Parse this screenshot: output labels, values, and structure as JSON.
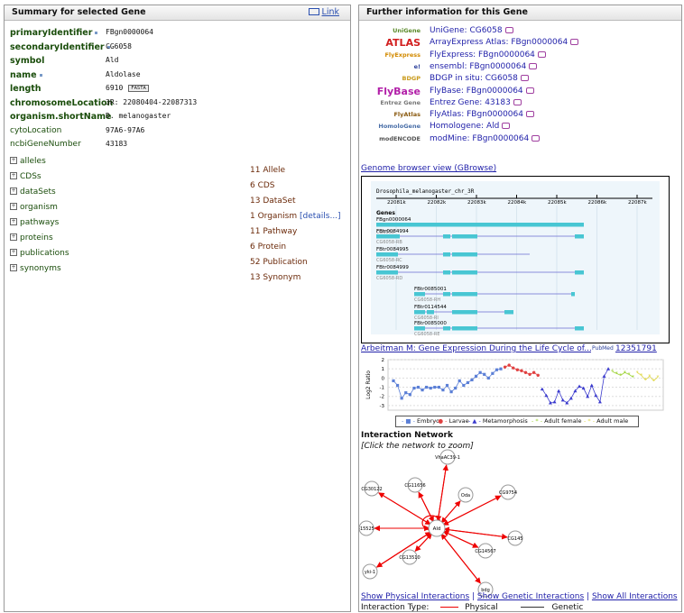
{
  "left_panel": {
    "title": "Summary for selected Gene",
    "link_label": "Link",
    "fields": [
      {
        "key": "primaryIdentifier",
        "value": "FBgn0000064",
        "bold": true,
        "dot": true
      },
      {
        "key": "secondaryIdentifier",
        "value": "CG6058",
        "bold": true,
        "dot": true
      },
      {
        "key": "symbol",
        "value": "Ald",
        "bold": true,
        "dot": false
      },
      {
        "key": "name",
        "value": "Aldolase",
        "bold": true,
        "dot": true
      },
      {
        "key": "length",
        "value": "6910",
        "bold": true,
        "dot": false,
        "fasta": "FASTA"
      },
      {
        "key": "chromosomeLocation",
        "value": "3R: 22080404-22087313",
        "bold": true,
        "dot": false
      },
      {
        "key": "organism.shortName",
        "value": "D. melanogaster",
        "bold": true,
        "dot": false
      },
      {
        "key": "cytoLocation",
        "value": "97A6-97A6",
        "bold": false,
        "dot": false
      },
      {
        "key": "ncbiGeneNumber",
        "value": "43183",
        "bold": false,
        "dot": false
      }
    ],
    "collections": [
      {
        "name": "alleles",
        "count": "11 Allele"
      },
      {
        "name": "CDSs",
        "count": "6 CDS"
      },
      {
        "name": "dataSets",
        "count": "13 DataSet"
      },
      {
        "name": "organism",
        "count": "1 Organism",
        "extra": "[details...]"
      },
      {
        "name": "pathways",
        "count": "11 Pathway"
      },
      {
        "name": "proteins",
        "count": "6 Protein"
      },
      {
        "name": "publications",
        "count": "52 Publication"
      },
      {
        "name": "synonyms",
        "count": "13 Synonym"
      }
    ]
  },
  "right_panel": {
    "title": "Further information for this Gene",
    "links": [
      {
        "logo": "UniGene",
        "logo_color": "#5b8a2a",
        "text": "UniGene: CG6058"
      },
      {
        "logo": "ATLAS",
        "logo_color": "#d21f1f",
        "text": "ArrayExpress Atlas: FBgn0000064"
      },
      {
        "logo": "FlyExpress",
        "logo_color": "#d28a00",
        "text": "FlyExpress: FBgn0000064"
      },
      {
        "logo": "e!",
        "logo_color": "#2a3f9a",
        "text": "ensembl: FBgn0000064"
      },
      {
        "logo": "BDGP",
        "logo_color": "#c99a1a",
        "text": "BDGP in situ: CG6058"
      },
      {
        "logo": "FlyBase",
        "logo_color": "#b21fa8",
        "text": "FlyBase: FBgn0000064"
      },
      {
        "logo": "Entrez Gene",
        "logo_color": "#777777",
        "text": "Entrez Gene: 43183"
      },
      {
        "logo": "FlyAtlas",
        "logo_color": "#8a5a10",
        "text": "FlyAtlas: FBgn0000064"
      },
      {
        "logo": "HomoloGene",
        "logo_color": "#4a6fa8",
        "text": "Homologene: Ald"
      },
      {
        "logo": "modENCODE",
        "logo_color": "#555555",
        "text": "modMine: FBgn0000064"
      }
    ],
    "genome_browser_label": "Genome browser view (GBrowse)",
    "gbrowse": {
      "chrom_label": "Drosophila_melanogaster_chr_3R",
      "ticks": [
        "22081k",
        "22082k",
        "22083k",
        "22084k",
        "22085k",
        "22086k",
        "22087k"
      ],
      "genes_label": "Genes",
      "gene_id": "FBgn0000064",
      "gene_sub": "CG6058",
      "transcripts": [
        {
          "id": "FBtr0084994",
          "sub": "CG6058-RB"
        },
        {
          "id": "FBtr0084995",
          "sub": "CG6058-RC"
        },
        {
          "id": "FBtr0084999",
          "sub": "CG6058-RD"
        },
        {
          "id": "FBtr0085001",
          "sub": "CG6058-RH"
        },
        {
          "id": "FBtr0114544",
          "sub": "CG6058-RI"
        },
        {
          "id": "FBtr0085000",
          "sub": "CG6058-RE"
        }
      ]
    },
    "expression_title": "Arbeitman M: Gene Expression During the Life Cycle of...",
    "pubmed_label": "PubMed",
    "pubmed_id": "12351791",
    "chart_data": {
      "type": "line",
      "ylabel": "Log2 Ratio",
      "ylim": [
        -3.5,
        2
      ],
      "yticks": [
        "2",
        "1",
        "0",
        "-1",
        "-2",
        "-3"
      ],
      "series": [
        {
          "name": "Embryo",
          "color": "#5b7fd6",
          "marker": "square",
          "values": [
            -0.3,
            -0.8,
            -2.2,
            -1.6,
            -1.8,
            -1.1,
            -1.0,
            -1.3,
            -1.0,
            -1.1,
            -1.0,
            -1.0,
            -1.3,
            -0.8,
            -1.5,
            -1.1,
            -0.3,
            -0.8,
            -0.5,
            -0.2,
            0.2,
            0.6,
            0.4,
            0.0,
            0.5,
            0.9,
            1.0
          ]
        },
        {
          "name": "Larvae",
          "color": "#e04040",
          "marker": "circle",
          "values": [
            1.2,
            1.4,
            1.1,
            0.9,
            0.8,
            0.6,
            0.4,
            0.6,
            0.3
          ]
        },
        {
          "name": "Metamorphosis",
          "color": "#3a3acd",
          "marker": "triangle",
          "values": [
            -1.2,
            -1.9,
            -2.7,
            -2.6,
            -1.4,
            -2.4,
            -2.7,
            -2.2,
            -1.4,
            -0.9,
            -1.1,
            -2.0,
            -0.8,
            -1.9,
            -2.6,
            0.2,
            1.0
          ]
        },
        {
          "name": "Adult female",
          "color": "#9ad12e",
          "marker": "star",
          "values": [
            0.7,
            0.5,
            0.3,
            0.6,
            0.4,
            0.1
          ]
        },
        {
          "name": "Adult male",
          "color": "#e0d84a",
          "marker": "star",
          "values": [
            0.6,
            0.3,
            -0.2,
            0.2,
            -0.3,
            0.1
          ]
        }
      ]
    },
    "interaction": {
      "title": "Interaction Network",
      "subtitle": "[Click the network to zoom]",
      "center": "Ald",
      "nodes": [
        "VhaAC39-1",
        "CG11656",
        "Oda",
        "CG9754",
        "CG30122",
        "-15525",
        "CG145",
        "CG14567",
        "CG13510",
        "yki-1",
        "bdg"
      ],
      "links": [
        "Show Physical Interactions",
        "Show Genetic Interactions",
        "Show All Interactions"
      ],
      "type_label": "Interaction Type:",
      "physical_label": "Physical",
      "genetic_label": "Genetic"
    }
  }
}
